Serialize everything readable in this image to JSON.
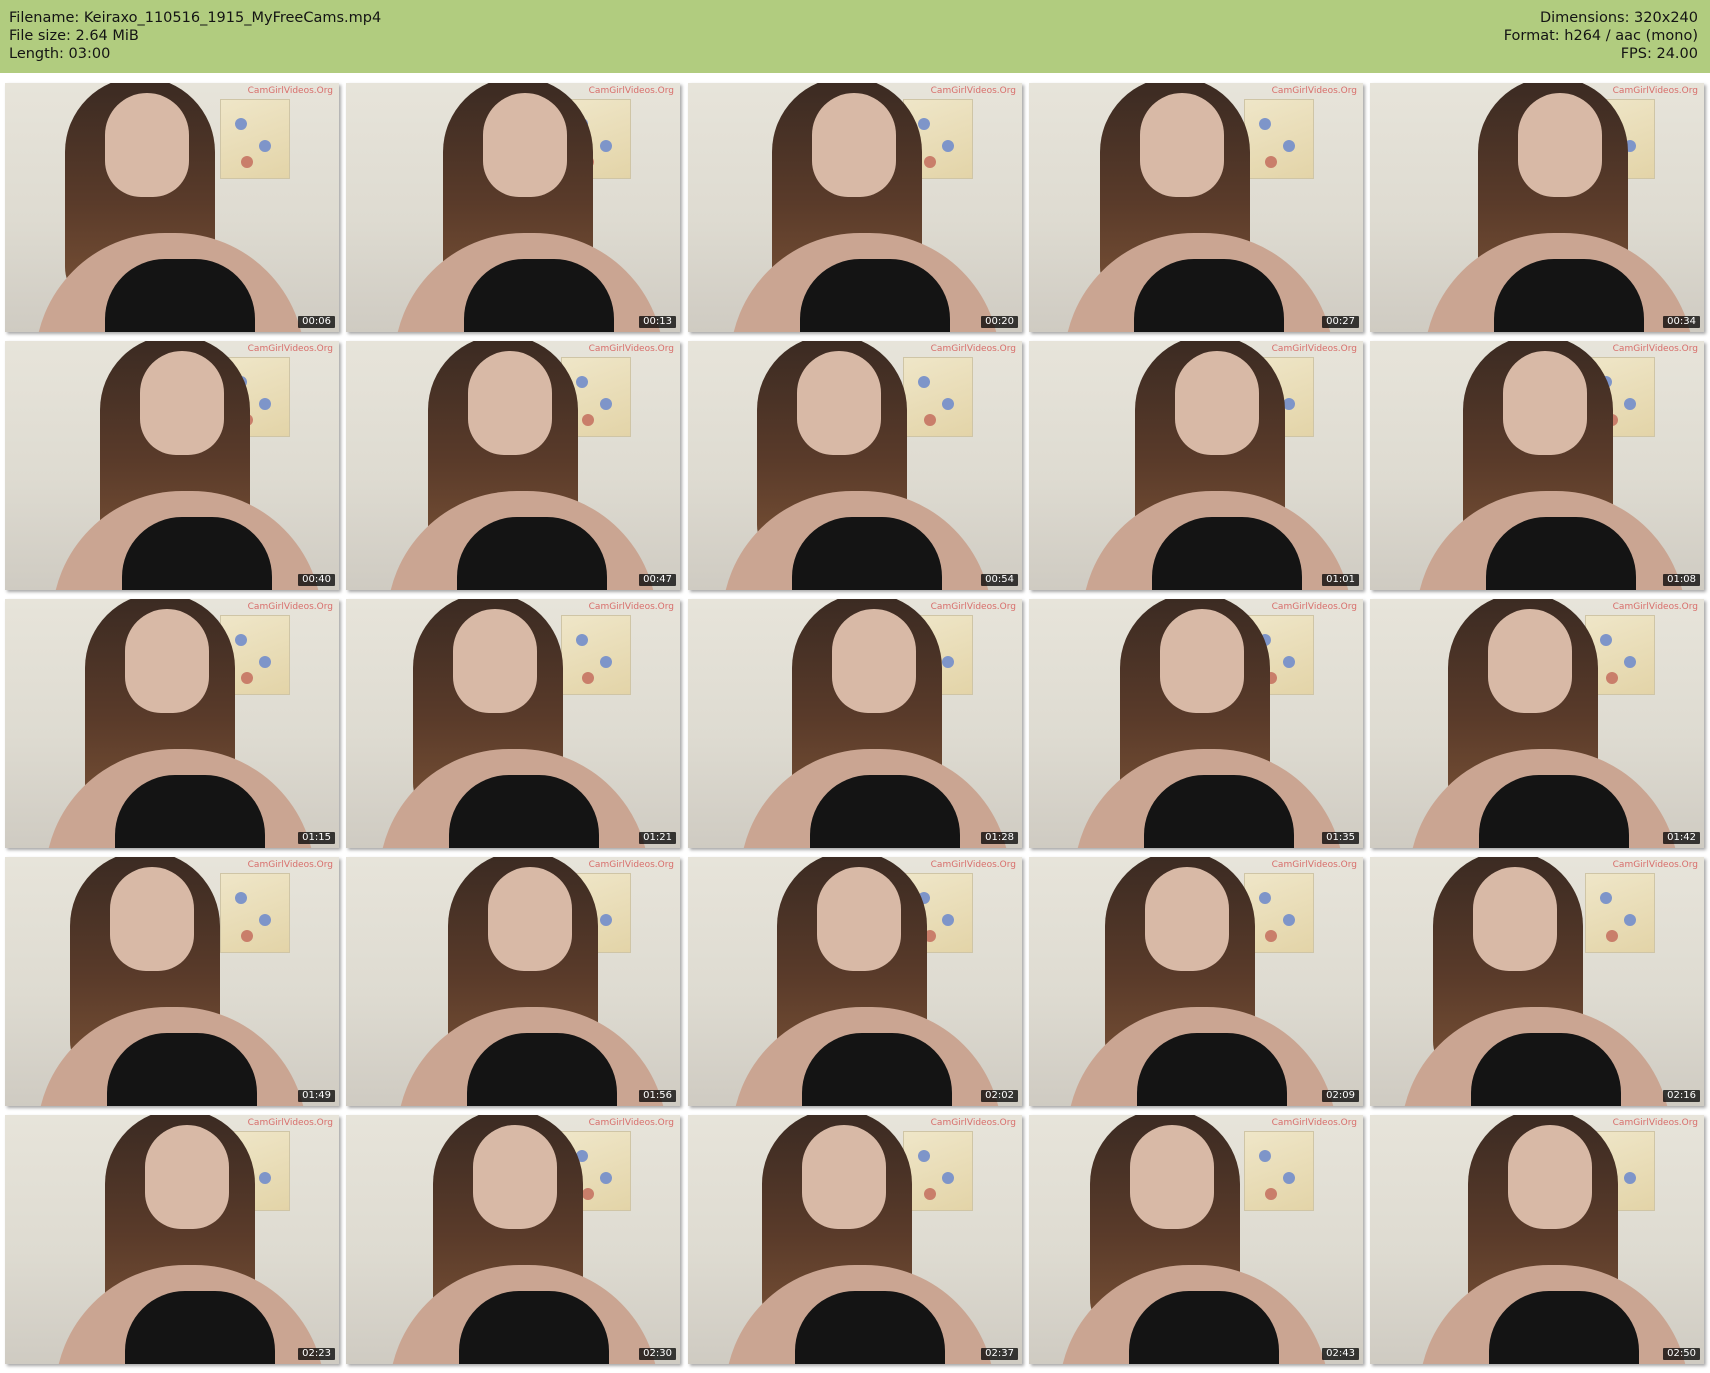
{
  "header": {
    "filename": "Filename: Keiraxo_110516_1915_MyFreeCams.mp4",
    "filesize": "File size: 2.64 MiB",
    "length": "Length: 03:00",
    "dimensions": "Dimensions: 320x240",
    "format": "Format: h264 / aac (mono)",
    "fps": "FPS: 24.00"
  },
  "thumbnails": [
    {
      "time": "00:06",
      "watermark": "CamGirlVideos.Org"
    },
    {
      "time": "00:13",
      "watermark": "CamGirlVideos.Org"
    },
    {
      "time": "00:20",
      "watermark": "CamGirlVideos.Org"
    },
    {
      "time": "00:27",
      "watermark": "CamGirlVideos.Org"
    },
    {
      "time": "00:34",
      "watermark": "CamGirlVideos.Org"
    },
    {
      "time": "00:40",
      "watermark": "CamGirlVideos.Org"
    },
    {
      "time": "00:47",
      "watermark": "CamGirlVideos.Org"
    },
    {
      "time": "00:54",
      "watermark": "CamGirlVideos.Org"
    },
    {
      "time": "01:01",
      "watermark": "CamGirlVideos.Org"
    },
    {
      "time": "01:08",
      "watermark": "CamGirlVideos.Org"
    },
    {
      "time": "01:15",
      "watermark": "CamGirlVideos.Org"
    },
    {
      "time": "01:21",
      "watermark": "CamGirlVideos.Org"
    },
    {
      "time": "01:28",
      "watermark": "CamGirlVideos.Org"
    },
    {
      "time": "01:35",
      "watermark": "CamGirlVideos.Org"
    },
    {
      "time": "01:42",
      "watermark": "CamGirlVideos.Org"
    },
    {
      "time": "01:49",
      "watermark": "CamGirlVideos.Org"
    },
    {
      "time": "01:56",
      "watermark": "CamGirlVideos.Org"
    },
    {
      "time": "02:02",
      "watermark": "CamGirlVideos.Org"
    },
    {
      "time": "02:09",
      "watermark": "CamGirlVideos.Org"
    },
    {
      "time": "02:16",
      "watermark": "CamGirlVideos.Org"
    },
    {
      "time": "02:23",
      "watermark": "CamGirlVideos.Org"
    },
    {
      "time": "02:30",
      "watermark": "CamGirlVideos.Org"
    },
    {
      "time": "02:37",
      "watermark": "CamGirlVideos.Org"
    },
    {
      "time": "02:43",
      "watermark": "CamGirlVideos.Org"
    },
    {
      "time": "02:50",
      "watermark": "CamGirlVideos.Org"
    }
  ],
  "colors": {
    "header_bg": "#b1cc7f",
    "timestamp_bg": "#000000"
  }
}
